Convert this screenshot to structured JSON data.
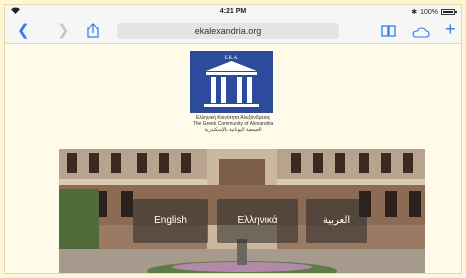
{
  "status": {
    "time": "4:21 PM",
    "battery": "100%",
    "battery_level": 1.0,
    "icons": [
      "wifi-icon",
      "bluetooth-icon",
      "battery-icon"
    ]
  },
  "toolbar": {
    "address": "ekalexandria.org",
    "icons": [
      "back-icon",
      "forward-icon",
      "share-icon",
      "bookmarks-icon",
      "cloud-tabs-icon",
      "new-tab-icon"
    ]
  },
  "logo": {
    "abbr": "Ε.Κ.Α.",
    "lines": [
      "Ελληνική Κοινότητα Αλεξάνδρειας",
      "The Greek Community of Alexandria",
      "الجمعية اليونانية بالإسكندرية"
    ]
  },
  "languages": [
    "English",
    "Ελληνικά",
    "العربية"
  ],
  "colors": {
    "accent": "#2f7bf5",
    "logo_bg": "#2d4a9c",
    "page_bg": "#fffbe8"
  }
}
